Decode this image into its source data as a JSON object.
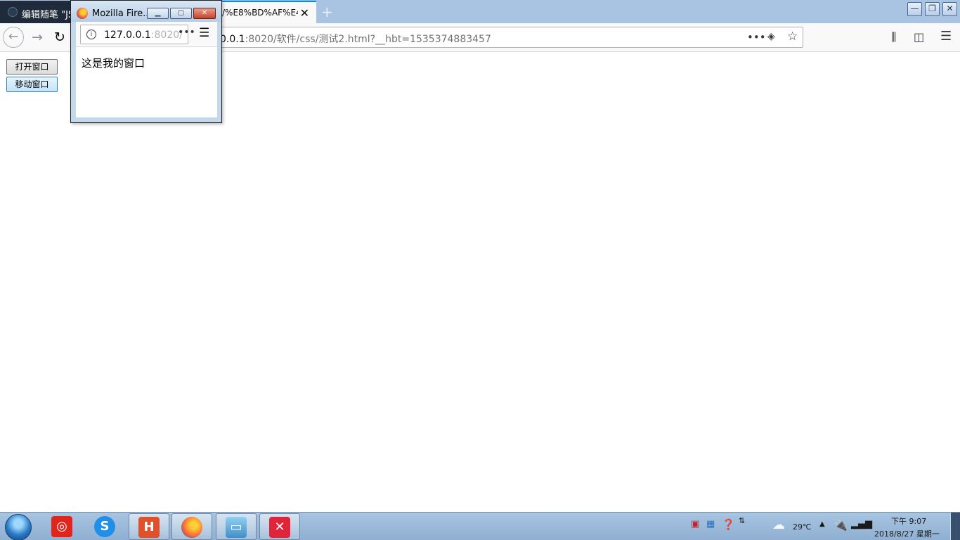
{
  "browser": {
    "tabs": [
      {
        "title": "编辑随笔 \"JS"
      },
      {
        "title": "/%E8%BD%AF%E4"
      }
    ],
    "url": {
      "host_visible": "0.0.1",
      "rest": ":8020/软件/css/测试2.html?__hbt=1535374883457"
    },
    "window_controls": {
      "minimize": "—",
      "restore": "❐",
      "close": "✕"
    }
  },
  "page": {
    "buttons": [
      {
        "label": "打开窗口"
      },
      {
        "label": "移动窗口"
      }
    ]
  },
  "popup": {
    "title": "Mozilla Fire...",
    "url_host": "127.0.0.1",
    "url_rest": ":8020/",
    "content_text": "这是我的窗口"
  },
  "taskbar": {
    "apps": [
      {
        "icon": "netease-music-icon",
        "color": "#e0261c"
      },
      {
        "icon": "sogou-browser-icon",
        "color": "#1f8fe8"
      },
      {
        "icon": "hbuilder-icon",
        "color": "#e0502a"
      },
      {
        "icon": "firefox-icon",
        "color": "#ff7139"
      },
      {
        "icon": "photo-viewer-icon",
        "color": "#3f8fc8"
      },
      {
        "icon": "xmind-icon",
        "color": "#e0243a"
      }
    ],
    "tray": {
      "temperature": "29℃",
      "time": "下午 9:07",
      "date": "2018/8/27 星期一"
    }
  }
}
